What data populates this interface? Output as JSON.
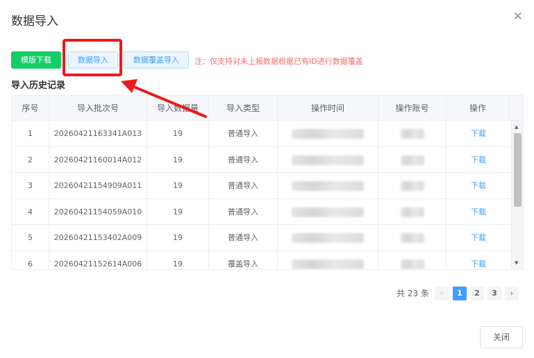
{
  "dialog": {
    "title": "数据导入",
    "close_icon": "close-icon"
  },
  "toolbar": {
    "template_download": "模版下载",
    "data_import": "数据导入",
    "data_cover_import": "数据覆盖导入",
    "note": "注：仅支持对未上报数据根据已有ID进行数据覆盖",
    "colors": {
      "success": "#13ce66",
      "primary": "#409eff",
      "danger": "#f56c6c",
      "annotation": "#f01818"
    }
  },
  "history": {
    "title": "导入历史记录",
    "columns": [
      "序号",
      "导入批次号",
      "导入数据量",
      "导入类型",
      "操作时间",
      "操作账号",
      "操作"
    ],
    "rows": [
      {
        "index": "1",
        "batch": "20260421163341A013",
        "count": "19",
        "type": "普通导入",
        "action": "下载"
      },
      {
        "index": "2",
        "batch": "20260421160014A012",
        "count": "19",
        "type": "普通导入",
        "action": "下载"
      },
      {
        "index": "3",
        "batch": "20260421154909A011",
        "count": "19",
        "type": "普通导入",
        "action": "下载"
      },
      {
        "index": "4",
        "batch": "20260421154059A010",
        "count": "19",
        "type": "普通导入",
        "action": "下载"
      },
      {
        "index": "5",
        "batch": "20260421153402A009",
        "count": "19",
        "type": "普通导入",
        "action": "下载"
      },
      {
        "index": "6",
        "batch": "20260421152614A006",
        "count": "19",
        "type": "覆盖导入",
        "action": "下载"
      }
    ]
  },
  "pagination": {
    "total": "共 23 条",
    "pages": [
      "1",
      "2",
      "3"
    ],
    "current": "1",
    "prev_icon": "chevron-left-icon",
    "next_icon": "chevron-right-icon"
  },
  "footer": {
    "close_label": "关闭"
  }
}
